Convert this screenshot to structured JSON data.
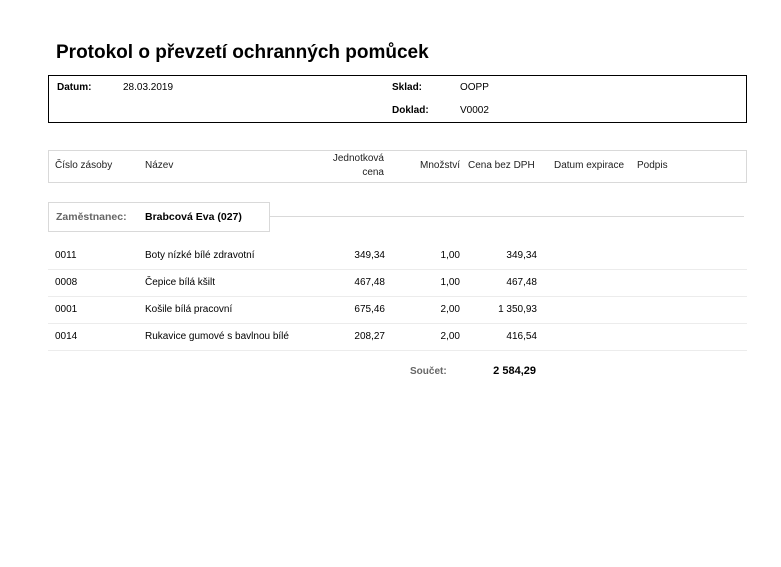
{
  "document": {
    "title": "Protokol o převzetí ochranných pomůcek"
  },
  "header": {
    "datum_label": "Datum:",
    "datum_value": "28.03.2019",
    "sklad_label": "Sklad:",
    "sklad_value": "OOPP",
    "doklad_label": "Doklad:",
    "doklad_value": "V0002"
  },
  "columns": {
    "cislo": "Číslo zásoby",
    "nazev": "Název",
    "jednotkova_1": "Jednotková",
    "jednotkova_2": "cena",
    "mnozstvi": "Množství",
    "cena_bez_dph": "Cena bez DPH",
    "datum_expirace": "Datum expirace",
    "podpis": "Podpis"
  },
  "employee": {
    "label": "Zaměstnanec:",
    "name": "Brabcová Eva (027)"
  },
  "rows": [
    {
      "cislo": "0011",
      "nazev": "Boty nízké bílé zdravotní",
      "cena": "349,34",
      "mnozstvi": "1,00",
      "cena_bez_dph": "349,34"
    },
    {
      "cislo": "0008",
      "nazev": "Čepice bílá kšilt",
      "cena": "467,48",
      "mnozstvi": "1,00",
      "cena_bez_dph": "467,48"
    },
    {
      "cislo": "0001",
      "nazev": "Košile bílá pracovní",
      "cena": "675,46",
      "mnozstvi": "2,00",
      "cena_bez_dph": "1 350,93"
    },
    {
      "cislo": "0014",
      "nazev": "Rukavice gumové s bavlnou bílé",
      "cena": "208,27",
      "mnozstvi": "2,00",
      "cena_bez_dph": "416,54"
    }
  ],
  "total": {
    "label": "Součet:",
    "value": "2 584,29"
  }
}
